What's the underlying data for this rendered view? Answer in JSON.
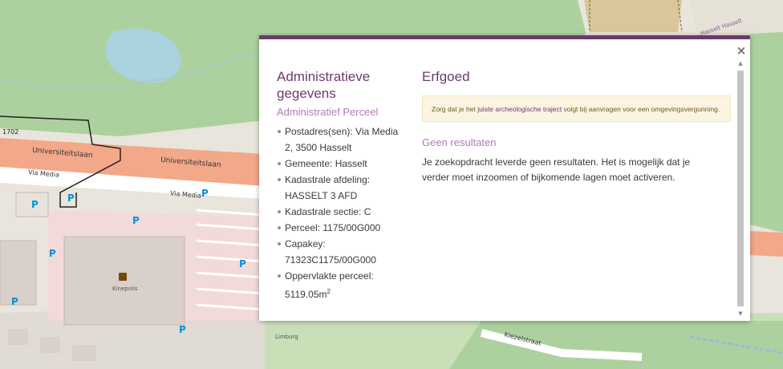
{
  "map": {
    "streets": {
      "universiteitslaan_left": "Universiteitslaan",
      "universiteitslaan_right": "Universiteitslaan",
      "via_media_left": "Via Media",
      "via_media_right": "Via Media",
      "kiezelstraat": "Kiezelstraat",
      "hasselt_top": "Hasselt Hasselt"
    },
    "labels": {
      "parcel_number": "1702",
      "kinepolis": "Kinepolis",
      "limburg": "Limburg",
      "parking": "P"
    }
  },
  "popup": {
    "close_label": "×",
    "left": {
      "title": "Administratieve gegevens",
      "subtitle": "Administratief Perceel",
      "items": [
        "Postadres(sen): Via Media 2, 3500 Hasselt",
        "Gemeente: Hasselt",
        "Kadastrale afdeling: HASSELT 3 AFD",
        "Kadastrale sectie: C",
        "Perceel: 1175/00G000",
        "Capakey: 71323C1175/00G000",
        "Oppervlakte perceel:"
      ],
      "area_value": "5119.05m",
      "area_sup": "2"
    },
    "right": {
      "title": "Erfgoed",
      "notice_pre": "Zorg dat je het",
      "notice_link": "juiste archeologische traject",
      "notice_post": "volgt bij aanvragen voor een omgevingsvergunning.",
      "no_results_title": "Geen resultaten",
      "no_results_text": "Je zoekopdracht leverde geen resultaten. Het is mogelijk dat je verder moet inzoomen of bijkomende lagen moet activeren."
    }
  },
  "colors": {
    "accent": "#6b3b6e",
    "accent_light": "#b07bb8",
    "notice_bg": "#fbf4e1",
    "road": "#f3a88a",
    "forest": "#add19e"
  }
}
